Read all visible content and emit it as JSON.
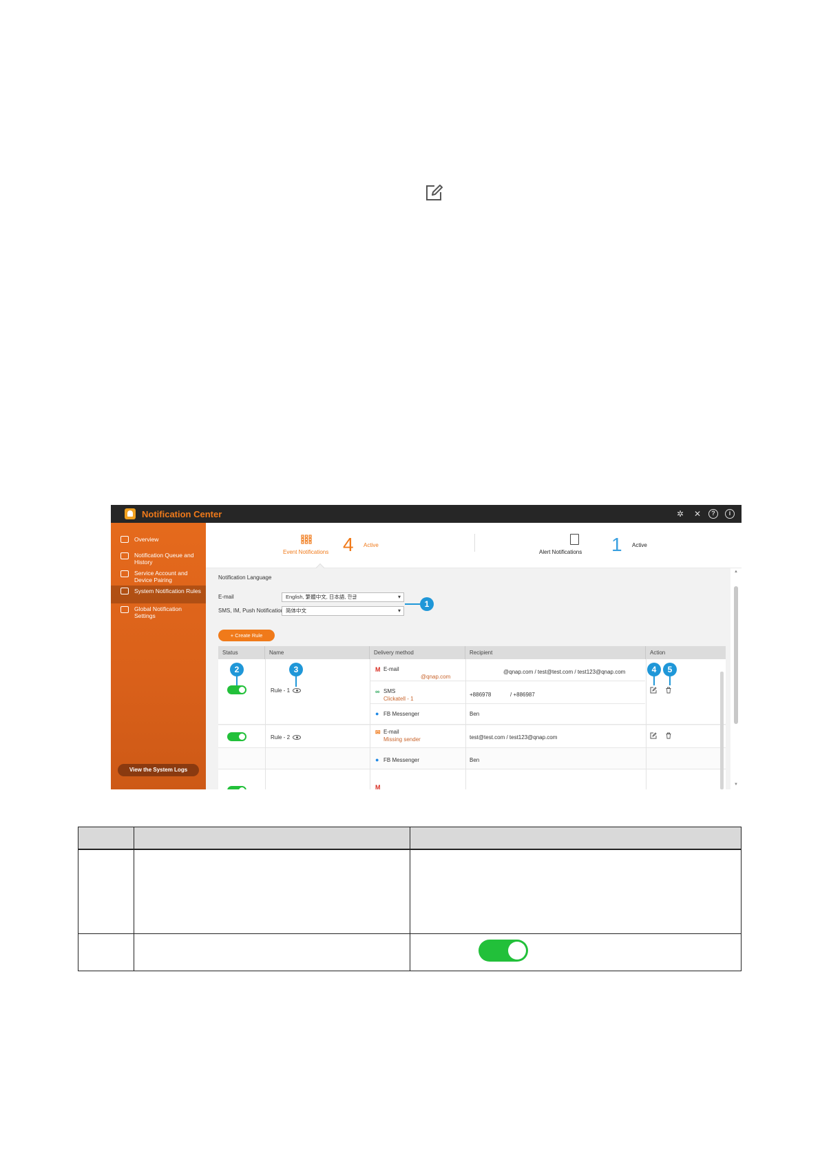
{
  "app": {
    "title": "Notification Center"
  },
  "sidebar": {
    "items": [
      {
        "label": "Overview"
      },
      {
        "label": "Notification Queue and History"
      },
      {
        "label": "Service Account and Device Pairing"
      },
      {
        "label": "System Notification Rules"
      },
      {
        "label": "Global Notification Settings"
      }
    ],
    "active_index": 3,
    "logs_button": "View the System Logs"
  },
  "summary": {
    "event": {
      "label": "Event Notifications",
      "count": "4",
      "status": "Active"
    },
    "alert": {
      "label": "Alert Notifications",
      "count": "1",
      "status": "Active"
    }
  },
  "language": {
    "title": "Notification Language",
    "email_label": "E-mail",
    "email_value": "English, 繁體中文, 日本語, 한글",
    "sms_label": "SMS, IM, Push Notification",
    "sms_value": "简体中文"
  },
  "create_rule_label": "Create Rule",
  "table": {
    "headers": [
      "Status",
      "Name",
      "Delivery method",
      "Recipient",
      "Action"
    ],
    "rules": [
      {
        "enabled": true,
        "name": "Rule - 1",
        "methods": [
          {
            "icon": "gmail-icon",
            "name": "E-mail",
            "detail": "@qnap.com",
            "recipient": "@qnap.com / test@test.com / test123@qnap.com"
          },
          {
            "icon": "sms-icon",
            "name": "SMS",
            "detail": "Clickatell - 1",
            "recipient_a": "+886978",
            "recipient_b": "/ +886987"
          },
          {
            "icon": "messenger-icon",
            "name": "FB Messenger",
            "detail": "",
            "recipient": "Ben"
          }
        ]
      },
      {
        "enabled": true,
        "name": "Rule - 2",
        "methods": [
          {
            "icon": "email-icon",
            "name": "E-mail",
            "detail": "Missing sender",
            "recipient": "test@test.com / test123@qnap.com"
          },
          {
            "icon": "messenger-icon",
            "name": "FB Messenger",
            "detail": "",
            "recipient": "Ben"
          }
        ]
      }
    ]
  },
  "callouts": [
    "1",
    "2",
    "3",
    "4",
    "5"
  ],
  "colors": {
    "brand_orange": "#f07a1a",
    "callout_blue": "#1f97d8",
    "toggle_green": "#22c03a",
    "titlebar": "#262626"
  },
  "doc_table": {
    "rows": 3,
    "columns": 3,
    "toggle_state": "on"
  }
}
